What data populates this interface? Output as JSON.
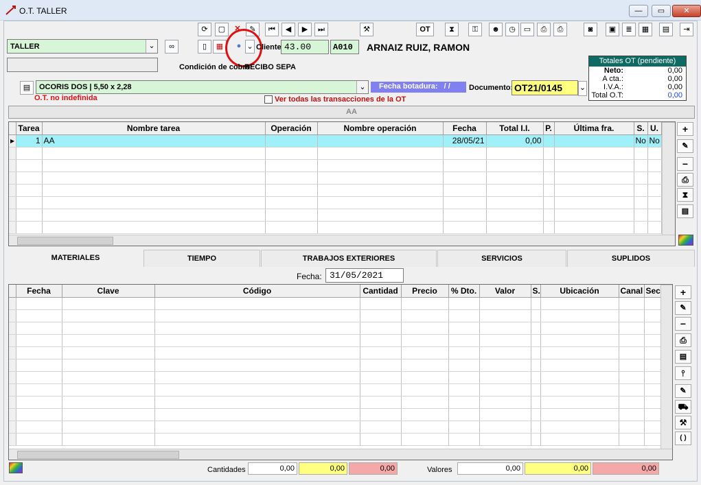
{
  "window": {
    "title": "O.T. TALLER",
    "minimize": "—",
    "maximize": "▭",
    "close": "✕"
  },
  "toolbar": {
    "ot_label": "OT",
    "icons_row1": [
      "refresh-icon",
      "new-doc-icon",
      "delete-icon",
      "edit-doc-icon",
      "first-icon",
      "prev-icon",
      "next-icon",
      "last-icon",
      "tools-icon",
      "ot-icon",
      "hourglass-icon",
      "key-icon",
      "people-icon",
      "clock-icon",
      "folder-icon",
      "print-preview-icon",
      "print-icon",
      "camera-icon",
      "photo-icon",
      "scan-icon",
      "calculator-icon",
      "notes-icon",
      "exit-icon"
    ]
  },
  "header": {
    "workshop": "TALLER",
    "cliente_label": "Cliente:",
    "cliente_num": "43.00",
    "cliente_code": "A010",
    "cliente_name": "ARNAIZ RUIZ, RAMON",
    "condicion_label": "Condición de cobro:",
    "condicion_value": "RECIBO SEPA",
    "vehicle": "OCORIS DOS | 5,50 x 2,28",
    "fecha_botadura_label": "Fecha botadura:",
    "fecha_botadura_value": "/ /",
    "documento_label": "Documento:",
    "documento_value": "OT21/0145",
    "ot_status": "O.T. no indefinida",
    "ver_todas": "Ver todas las transacciones de la OT",
    "banner": "AA"
  },
  "totals": {
    "title": "Totales OT (pendiente)",
    "rows": [
      {
        "label": "Neto:",
        "value": "0,00"
      },
      {
        "label": "A cta.:",
        "value": "0,00"
      },
      {
        "label": "I.V.A.:",
        "value": "0,00"
      },
      {
        "label": "Total O.T:",
        "value": "0,00"
      }
    ]
  },
  "tasks_table": {
    "columns": [
      "Tarea",
      "Nombre tarea",
      "Operación",
      "Nombre operación",
      "Fecha",
      "Total I.I.",
      "P.",
      "Última fra.",
      "S.",
      "U."
    ],
    "rows": [
      [
        "1",
        "AA",
        "",
        "",
        "28/05/21",
        "0,00",
        "",
        "",
        "No",
        "No"
      ]
    ]
  },
  "tabs": [
    "MATERIALES",
    "TIEMPO",
    "TRABAJOS EXTERIORES",
    "SERVICIOS",
    "SUPLIDOS"
  ],
  "materials": {
    "fecha_label": "Fecha:",
    "fecha_value": "31/05/2021",
    "columns": [
      "Fecha",
      "Clave",
      "Código",
      "Cantidad",
      "Precio",
      "% Dto.",
      "Valor",
      "S.",
      "Ubicación",
      "Canal",
      "Secc"
    ]
  },
  "footer": {
    "cantidades_label": "Cantidades",
    "cantidades": [
      "0,00",
      "0,00",
      "0,00"
    ],
    "valores_label": "Valores",
    "valores": [
      "0,00",
      "0,00",
      "0,00"
    ]
  },
  "colors": {
    "green_field": "#d7f5d7",
    "selected_row": "#9ff0f8",
    "totals_header": "#0d6b63",
    "fecha_bot_bg": "#8080f0",
    "documento_bg": "#ffff80",
    "footer_yellow": "#ffff80",
    "footer_pink": "#f5a8a8"
  }
}
